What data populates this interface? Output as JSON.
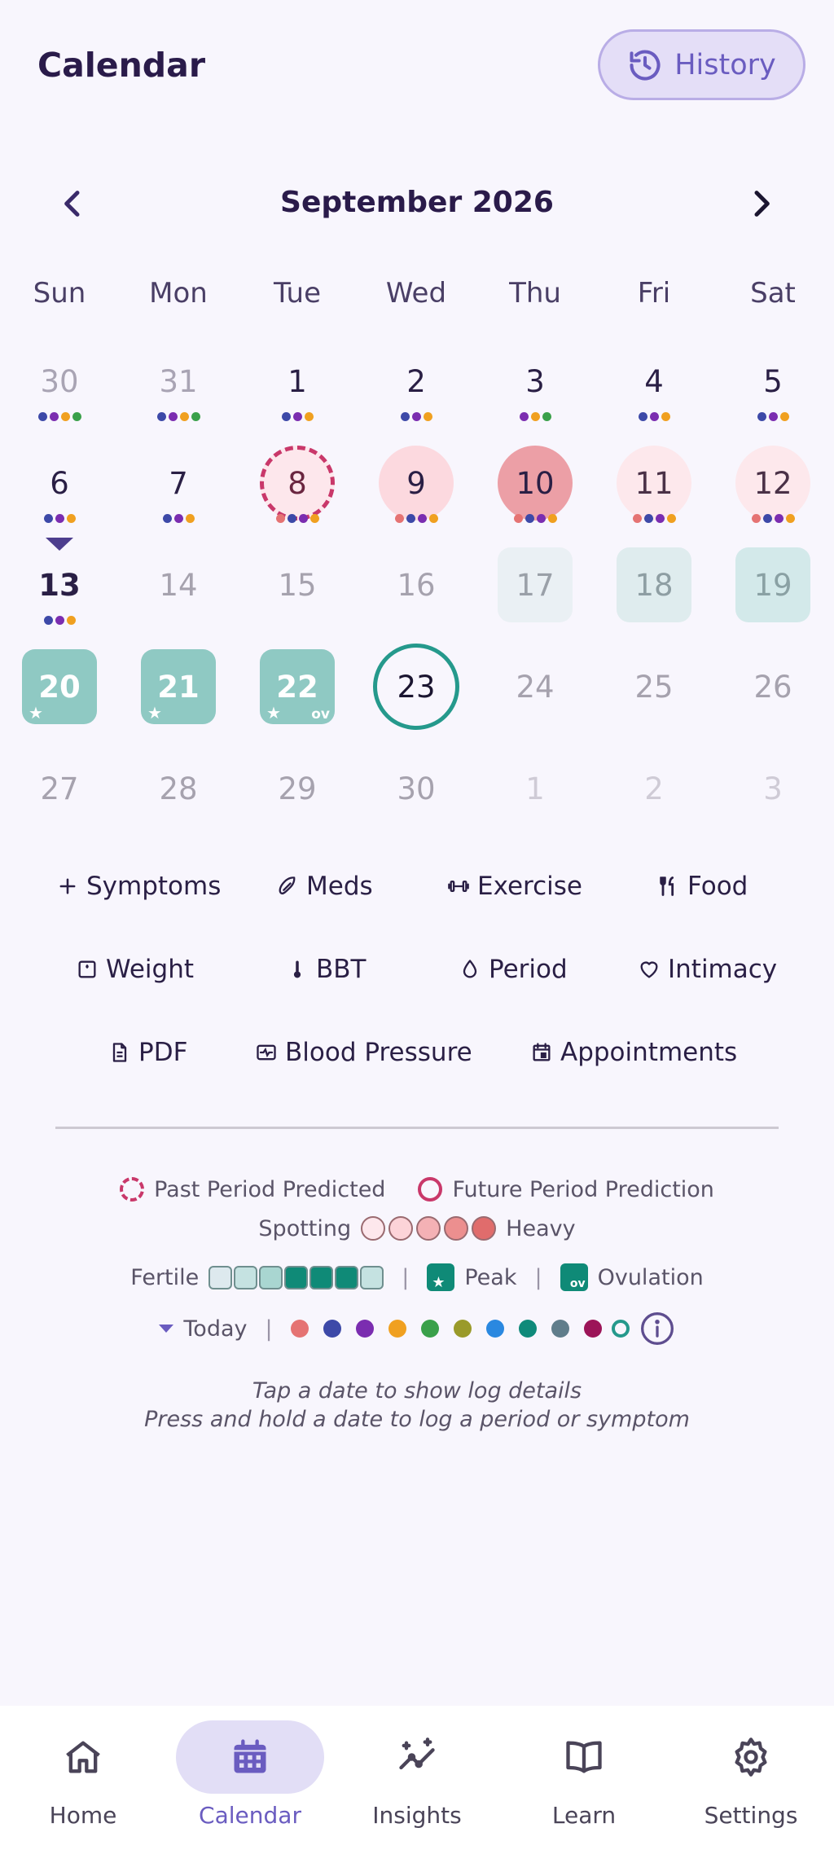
{
  "header": {
    "title": "Calendar",
    "history_label": "History"
  },
  "month_title": "September 2026",
  "weekdays": [
    "Sun",
    "Mon",
    "Tue",
    "Wed",
    "Thu",
    "Fri",
    "Sat"
  ],
  "colors": {
    "accent": "#6a5cc0",
    "period": "#c9386a",
    "fertile_peak": "#8fc9c3",
    "ovulation": "#0f8a77",
    "today_ring": "#25998c"
  },
  "days": [
    {
      "label": "30",
      "style": "out",
      "dots": [
        "#3d49a8",
        "#7b2db0",
        "#f0a020",
        "#3aa04a"
      ]
    },
    {
      "label": "31",
      "style": "out",
      "dots": [
        "#3d49a8",
        "#7b2db0",
        "#f0a020",
        "#3aa04a"
      ]
    },
    {
      "label": "1",
      "style": "normal",
      "dots": [
        "#3d49a8",
        "#7b2db0",
        "#f0a020"
      ]
    },
    {
      "label": "2",
      "style": "normal",
      "dots": [
        "#3d49a8",
        "#7b2db0",
        "#f0a020"
      ]
    },
    {
      "label": "3",
      "style": "normal",
      "dots": [
        "#7b2db0",
        "#f0a020",
        "#3aa04a"
      ]
    },
    {
      "label": "4",
      "style": "normal",
      "dots": [
        "#3d49a8",
        "#7b2db0",
        "#f0a020"
      ]
    },
    {
      "label": "5",
      "style": "normal",
      "dots": [
        "#3d49a8",
        "#7b2db0",
        "#f0a020"
      ]
    },
    {
      "label": "6",
      "style": "normal",
      "dots": [
        "#3d49a8",
        "#7b2db0",
        "#f0a020"
      ]
    },
    {
      "label": "7",
      "style": "normal",
      "dots": [
        "#3d49a8",
        "#7b2db0",
        "#f0a020"
      ]
    },
    {
      "label": "8",
      "style": "period-pred",
      "dots": [
        "#e57373",
        "#3d49a8",
        "#7b2db0",
        "#f0a020"
      ]
    },
    {
      "label": "9",
      "style": "period-light",
      "dots": [
        "#e57373",
        "#3d49a8",
        "#7b2db0",
        "#f0a020"
      ]
    },
    {
      "label": "10",
      "style": "period-mid",
      "dots": [
        "#e57373",
        "#3d49a8",
        "#7b2db0",
        "#f0a020"
      ]
    },
    {
      "label": "11",
      "style": "period-faint",
      "dots": [
        "#e57373",
        "#3d49a8",
        "#7b2db0",
        "#f0a020"
      ]
    },
    {
      "label": "12",
      "style": "period-faint",
      "dots": [
        "#e57373",
        "#3d49a8",
        "#7b2db0",
        "#f0a020"
      ]
    },
    {
      "label": "13",
      "style": "today-bold",
      "dots": [
        "#3d49a8",
        "#7b2db0",
        "#f0a020"
      ]
    },
    {
      "label": "14",
      "style": "futr",
      "dots": []
    },
    {
      "label": "15",
      "style": "futr",
      "dots": []
    },
    {
      "label": "16",
      "style": "futr",
      "dots": []
    },
    {
      "label": "17",
      "style": "fert1",
      "dots": []
    },
    {
      "label": "18",
      "style": "fert2",
      "dots": []
    },
    {
      "label": "19",
      "style": "fert3",
      "dots": []
    },
    {
      "label": "20",
      "style": "peak",
      "star": "★",
      "dots": []
    },
    {
      "label": "21",
      "style": "peak",
      "star": "★",
      "dots": []
    },
    {
      "label": "22",
      "style": "peak",
      "star": "★",
      "ov": "ov",
      "dots": []
    },
    {
      "label": "23",
      "style": "today-ring",
      "dots": []
    },
    {
      "label": "24",
      "style": "futr",
      "dots": []
    },
    {
      "label": "25",
      "style": "futr",
      "dots": []
    },
    {
      "label": "26",
      "style": "futr",
      "dots": []
    },
    {
      "label": "27",
      "style": "futr",
      "dots": []
    },
    {
      "label": "28",
      "style": "futr",
      "dots": []
    },
    {
      "label": "29",
      "style": "futr",
      "dots": []
    },
    {
      "label": "30",
      "style": "futr",
      "dots": []
    },
    {
      "label": "1",
      "style": "faint",
      "dots": []
    },
    {
      "label": "2",
      "style": "faint",
      "dots": []
    },
    {
      "label": "3",
      "style": "faint",
      "dots": []
    }
  ],
  "quick_actions": {
    "row1": [
      {
        "icon": "plus-icon",
        "label": "Symptoms"
      },
      {
        "icon": "pill-icon",
        "label": "Meds"
      },
      {
        "icon": "dumbbell-icon",
        "label": "Exercise"
      },
      {
        "icon": "utensils-icon",
        "label": "Food"
      }
    ],
    "row2": [
      {
        "icon": "scale-icon",
        "label": "Weight"
      },
      {
        "icon": "thermometer-icon",
        "label": "BBT"
      },
      {
        "icon": "droplet-icon",
        "label": "Period"
      },
      {
        "icon": "heart-icon",
        "label": "Intimacy"
      }
    ],
    "row3": [
      {
        "icon": "document-icon",
        "label": "PDF"
      },
      {
        "icon": "blood-pressure-icon",
        "label": "Blood Pressure"
      },
      {
        "icon": "calendar-icon",
        "label": "Appointments"
      }
    ]
  },
  "legend": {
    "past_pred": "Past Period Predicted",
    "future_pred": "Future Period Prediction",
    "spotting": "Spotting",
    "heavy": "Heavy",
    "spot_colors": [
      "#fde7ec",
      "#fcd3d8",
      "#f4b1b5",
      "#ec8f8f",
      "#e06c6c"
    ],
    "fertile": "Fertile",
    "fertile_colors": [
      "#dde9ee",
      "#c5e2e1",
      "#a9d6d1",
      "#0f8a77",
      "#0f8a77",
      "#0f8a77",
      "#c5e2e1"
    ],
    "peak": "Peak",
    "ovulation": "Ovulation",
    "ov_badge": "ov",
    "star": "★",
    "today": "Today",
    "sep": "|",
    "dot_colors": [
      "#e57373",
      "#3d49a8",
      "#7b2db0",
      "#f0a020",
      "#3aa04a",
      "#9a9a2a",
      "#2a88e0",
      "#0f8a7a",
      "#607d8b",
      "#9c1458"
    ]
  },
  "hint": {
    "line1": "Tap a date to show log details",
    "line2": "Press and hold a date to log a period or symptom"
  },
  "nav": [
    {
      "icon": "home-icon",
      "label": "Home",
      "active": false
    },
    {
      "icon": "calendar-icon",
      "label": "Calendar",
      "active": true
    },
    {
      "icon": "insights-icon",
      "label": "Insights",
      "active": false
    },
    {
      "icon": "book-icon",
      "label": "Learn",
      "active": false
    },
    {
      "icon": "gear-icon",
      "label": "Settings",
      "active": false
    }
  ]
}
